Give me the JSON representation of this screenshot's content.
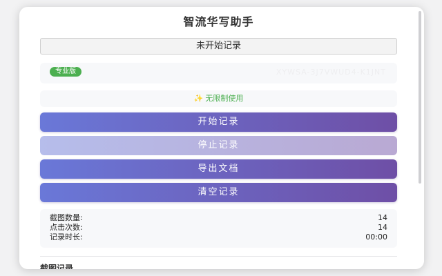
{
  "app": {
    "title": "智流华写助手"
  },
  "status": {
    "text": "未开始记录"
  },
  "license": {
    "badge": "专业版",
    "code": "XYWSA-3J7VWUD4-K1JNT"
  },
  "unlimited": {
    "icon": "sparkle-icon",
    "text": "无限制使用"
  },
  "buttons": {
    "start": "开始记录",
    "stop": "停止记录",
    "export": "导出文档",
    "clear": "清空记录"
  },
  "stats": {
    "screenshots_label": "截图数量:",
    "screenshots_value": "14",
    "clicks_label": "点击次数:",
    "clicks_value": "14",
    "duration_label": "记录时长:",
    "duration_value": "00:00"
  },
  "section": {
    "screenshots_title": "截图记录"
  },
  "colors": {
    "accent_start": "#6a78d8",
    "accent_end": "#6e4fa6",
    "badge_green": "#4caf50"
  }
}
